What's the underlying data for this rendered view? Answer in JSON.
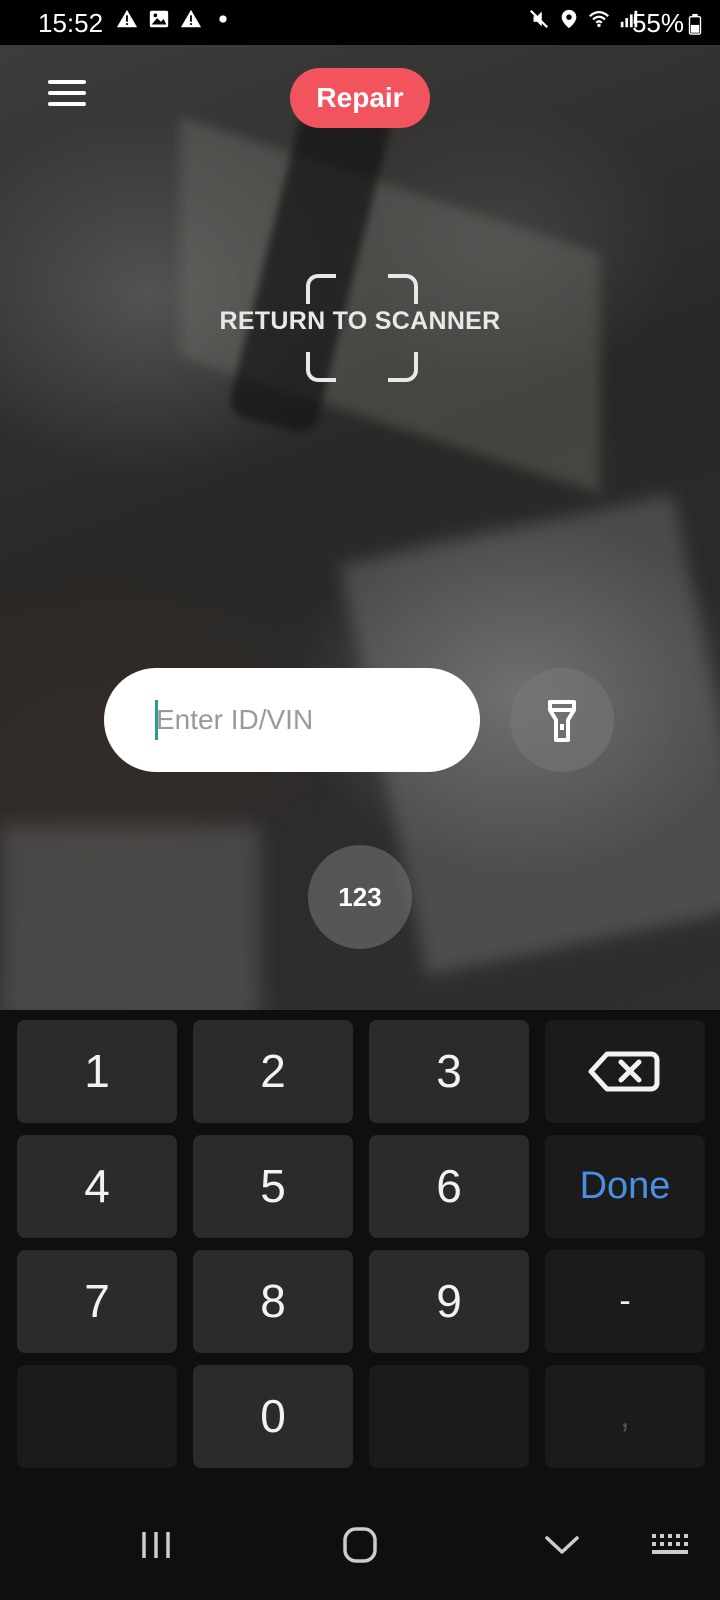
{
  "status_bar": {
    "time": "15:52",
    "battery": "55%",
    "left_icons": [
      "warning-icon",
      "image-icon",
      "warning-icon",
      "dot-icon"
    ],
    "right_icons": [
      "mute-icon",
      "location-icon",
      "wifi-icon",
      "signal-icon",
      "battery-icon"
    ]
  },
  "header": {
    "mode_label": "Repair",
    "mode_color": "#f2545e",
    "menu_icon": "hamburger-menu-icon"
  },
  "scanner": {
    "label": "RETURN TO SCANNER"
  },
  "input": {
    "placeholder": "Enter ID/VIN",
    "value": ""
  },
  "controls": {
    "flashlight_icon": "flashlight-icon",
    "keyboard_toggle_label": "123"
  },
  "keyboard": {
    "keys": [
      "1",
      "2",
      "3",
      "4",
      "5",
      "6",
      "7",
      "8",
      "9",
      "0"
    ],
    "done_label": "Done",
    "done_color": "#4a90e2",
    "dash_label": "-",
    "comma_label": ",",
    "backspace_icon": "backspace-icon"
  },
  "nav_bar": {
    "icons": [
      "recent-apps-icon",
      "home-icon",
      "back-icon",
      "keyboard-icon"
    ]
  }
}
